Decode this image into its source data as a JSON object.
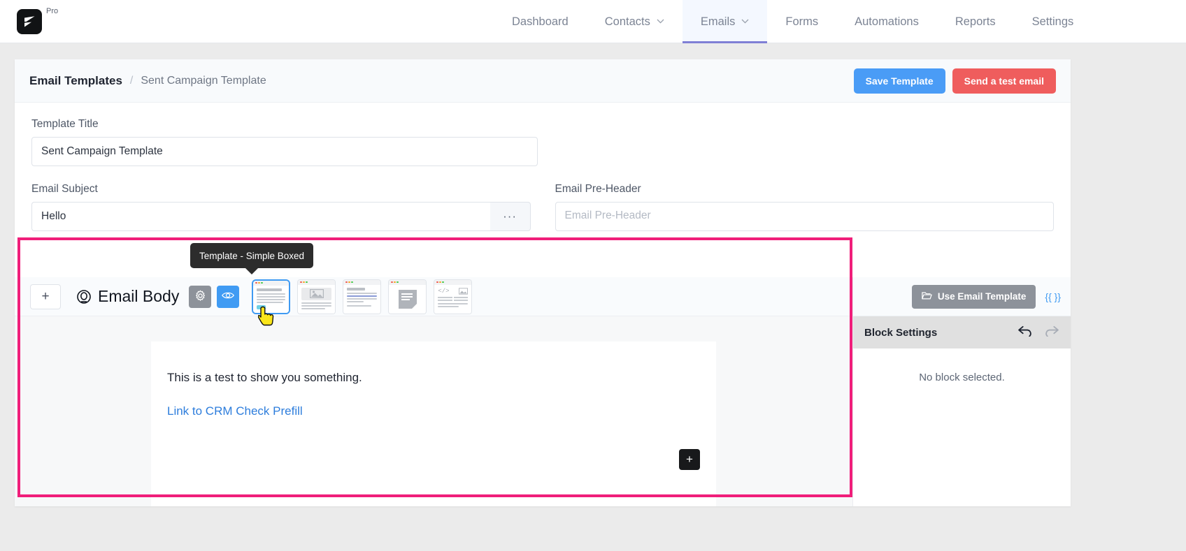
{
  "topnav": {
    "brand_badge": "Pro",
    "logo_icon": "fluentcrm-logo-icon",
    "items": [
      {
        "label": "Dashboard",
        "caret": "",
        "active": false
      },
      {
        "label": "Contacts",
        "caret": "⌄",
        "active": false
      },
      {
        "label": "Emails",
        "caret": "⌄",
        "active": true
      },
      {
        "label": "Forms",
        "caret": "",
        "active": false
      },
      {
        "label": "Automations",
        "caret": "",
        "active": false
      },
      {
        "label": "Reports",
        "caret": "",
        "active": false
      },
      {
        "label": "Settings",
        "caret": "",
        "active": false
      }
    ],
    "active_underline_color": "#7f7fd5",
    "active_bg_color": "#f4f8ff"
  },
  "breadcrumb": {
    "root": "Email Templates",
    "separator": "/",
    "current": "Sent Campaign Template"
  },
  "header_actions": {
    "save_label": "Save Template",
    "save_color": "#4a9cf6",
    "test_label": "Send a test email",
    "test_color": "#ef5d5d"
  },
  "form": {
    "title_label": "Template Title",
    "title_value": "Sent Campaign Template",
    "title_placeholder": "Template Title",
    "subject_label": "Email Subject",
    "subject_value": "Hello",
    "subject_placeholder": "Email Subject",
    "subject_more_button": "···",
    "preheader_label": "Email Pre-Header",
    "preheader_value": "",
    "preheader_placeholder": "Email Pre-Header"
  },
  "builder": {
    "add_block_button": "+",
    "body_title": "Email Body",
    "target_icon": "target-icon",
    "settings_icon": "gear-icon",
    "preview_icon": "eye-icon",
    "tooltip": "Template - Simple Boxed",
    "templates": [
      {
        "name": "Simple Boxed",
        "selected": true
      },
      {
        "name": "Image Header",
        "selected": false
      },
      {
        "name": "Plain Text Lines",
        "selected": false
      },
      {
        "name": "Note Card",
        "selected": false
      },
      {
        "name": "Raw HTML",
        "selected": false
      }
    ],
    "cursor_icon": "hand-pointer-cursor"
  },
  "preview": {
    "paragraph": "This is a test to show you something.",
    "link_text": "Link to CRM Check Prefill",
    "link_color": "#2d7ddc",
    "add_block_button": "+"
  },
  "right_panel": {
    "use_template_label": "Use Email Template",
    "use_template_icon": "folder-icon",
    "smartcode_label": "{{ }}",
    "block_settings_title": "Block Settings",
    "undo_icon": "undo-arrow-icon",
    "redo_icon": "redo-arrow-icon",
    "empty_message": "No block selected."
  },
  "highlight": {
    "color": "#f01e7a"
  }
}
